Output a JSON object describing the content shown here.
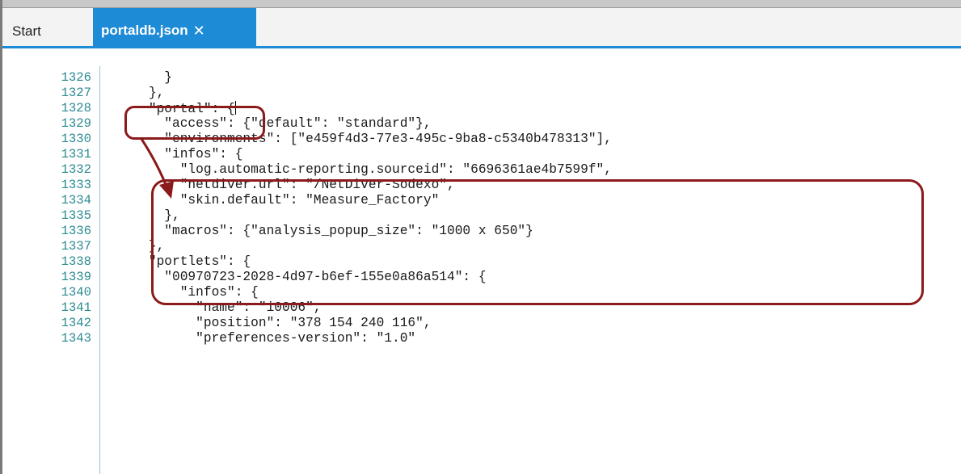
{
  "tabs": {
    "start_label": "Start",
    "active_label": "portaldb.json",
    "active_close": "✕"
  },
  "editor": {
    "lines": [
      {
        "num": "1326",
        "code": "      }"
      },
      {
        "num": "1327",
        "code": "    },"
      },
      {
        "num": "1328",
        "code": "    \"portal\": {"
      },
      {
        "num": "1329",
        "code": "      \"access\": {\"default\": \"standard\"},"
      },
      {
        "num": "1330",
        "code": "      \"environments\": [\"e459f4d3-77e3-495c-9ba8-c5340b478313\"],"
      },
      {
        "num": "1331",
        "code": "      \"infos\": {"
      },
      {
        "num": "1332",
        "code": "        \"log.automatic-reporting.sourceid\": \"6696361ae4b7599f\","
      },
      {
        "num": "1333",
        "code": "        \"netdiver.url\": \"/NetDiver-Sodexo\","
      },
      {
        "num": "1334",
        "code": "        \"skin.default\": \"Measure_Factory\""
      },
      {
        "num": "1335",
        "code": "      },"
      },
      {
        "num": "1336",
        "code": "      \"macros\": {\"analysis_popup_size\": \"1000 x 650\"}"
      },
      {
        "num": "1337",
        "code": "    },"
      },
      {
        "num": "1338",
        "code": "    \"portlets\": {"
      },
      {
        "num": "1339",
        "code": "      \"00970723-2028-4d97-b6ef-155e0a86a514\": {"
      },
      {
        "num": "1340",
        "code": "        \"infos\": {"
      },
      {
        "num": "1341",
        "code": "          \"name\": \"i0006\","
      },
      {
        "num": "1342",
        "code": "          \"position\": \"378 154 240 116\","
      },
      {
        "num": "1343",
        "code": "          \"preferences-version\": \"1.0\""
      }
    ]
  },
  "colors": {
    "tab_accent": "#1e8bd6",
    "line_number": "#2b8a91",
    "annotation": "#8b1a1a"
  }
}
